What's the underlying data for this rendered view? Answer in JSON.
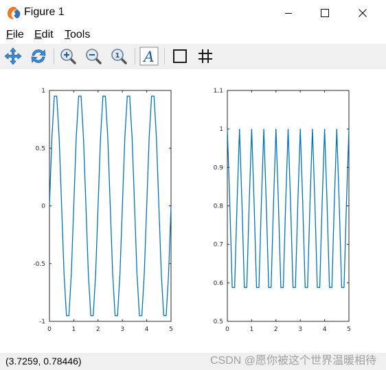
{
  "window": {
    "title": "Figure 1",
    "controls": [
      "minimize",
      "maximize",
      "close"
    ]
  },
  "menu": {
    "items": [
      {
        "label": "File",
        "mnemonic": "F",
        "rest": "ile"
      },
      {
        "label": "Edit",
        "mnemonic": "E",
        "rest": "dit"
      },
      {
        "label": "Tools",
        "mnemonic": "T",
        "rest": "ools"
      }
    ]
  },
  "toolbar": {
    "tools": [
      "pan-icon",
      "rotate-icon",
      "zoom-in-icon",
      "zoom-out-icon",
      "zoom-reset-icon",
      "text-icon",
      "axes-box-icon",
      "grid-icon"
    ],
    "text_tool_glyph": "A"
  },
  "status": {
    "coords": "(3.7259, 0.78446)",
    "watermark": "CSDN @愿你被这个世界温暖相待"
  },
  "colors": {
    "line": "#0072bd",
    "toolbar_bg": "#f0f0f0",
    "figure_bg": "#ffffff"
  },
  "chart_data": [
    {
      "type": "line",
      "title": "",
      "xlabel": "",
      "ylabel": "",
      "xlim": [
        0,
        5
      ],
      "ylim": [
        -1,
        1
      ],
      "xticks": [
        "0",
        "1",
        "2",
        "3",
        "4",
        "5"
      ],
      "yticks": [
        "-1",
        "-0.5",
        "0",
        "0.5",
        "1"
      ],
      "series": [
        {
          "x": [
            0,
            0.1,
            0.2,
            0.3,
            0.4,
            0.5,
            0.6,
            0.7,
            0.8,
            0.9,
            1.0,
            1.1,
            1.2,
            1.3,
            1.4,
            1.5,
            1.6,
            1.7,
            1.8,
            1.9,
            2.0,
            2.1,
            2.2,
            2.3,
            2.4,
            2.5,
            2.6,
            2.7,
            2.8,
            2.9,
            3.0,
            3.1,
            3.2,
            3.3,
            3.4,
            3.5,
            3.6,
            3.7,
            3.8,
            3.9,
            4.0,
            4.1,
            4.2,
            4.3,
            4.4,
            4.5,
            4.6,
            4.7,
            4.8,
            4.9,
            5.0
          ],
          "y": [
            0,
            0.588,
            0.951,
            0.951,
            0.588,
            0,
            -0.588,
            -0.951,
            -0.951,
            -0.588,
            0,
            0.588,
            0.951,
            0.951,
            0.588,
            0,
            -0.588,
            -0.951,
            -0.951,
            -0.588,
            0,
            0.588,
            0.951,
            0.951,
            0.588,
            0,
            -0.588,
            -0.951,
            -0.951,
            -0.588,
            0,
            0.588,
            0.951,
            0.951,
            0.588,
            0,
            -0.588,
            -0.951,
            -0.951,
            -0.588,
            0,
            0.588,
            0.951,
            0.951,
            0.588,
            0,
            -0.588,
            -0.951,
            -0.951,
            -0.588,
            0
          ]
        }
      ]
    },
    {
      "type": "line",
      "title": "",
      "xlabel": "",
      "ylabel": "",
      "xlim": [
        0,
        5
      ],
      "ylim": [
        0.5,
        1.1
      ],
      "xticks": [
        "0",
        "1",
        "2",
        "3",
        "4",
        "5"
      ],
      "yticks": [
        "0.5",
        "0.6",
        "0.7",
        "0.8",
        "0.9",
        "1",
        "1.1"
      ],
      "series": [
        {
          "x": [
            0,
            0.1,
            0.2,
            0.3,
            0.4,
            0.5,
            0.6,
            0.7,
            0.8,
            0.9,
            1.0,
            1.1,
            1.2,
            1.3,
            1.4,
            1.5,
            1.6,
            1.7,
            1.8,
            1.9,
            2.0,
            2.1,
            2.2,
            2.3,
            2.4,
            2.5,
            2.6,
            2.7,
            2.8,
            2.9,
            3.0,
            3.1,
            3.2,
            3.3,
            3.4,
            3.5,
            3.6,
            3.7,
            3.8,
            3.9,
            4.0,
            4.1,
            4.2,
            4.3,
            4.4,
            4.5,
            4.6,
            4.7,
            4.8,
            4.9,
            5.0
          ],
          "y": [
            1.0,
            0.809,
            0.588,
            0.588,
            0.809,
            1.0,
            0.809,
            0.588,
            0.588,
            0.809,
            1.0,
            0.809,
            0.588,
            0.588,
            0.809,
            1.0,
            0.809,
            0.588,
            0.588,
            0.809,
            1.0,
            0.809,
            0.588,
            0.588,
            0.809,
            1.0,
            0.809,
            0.588,
            0.588,
            0.809,
            1.0,
            0.809,
            0.588,
            0.588,
            0.809,
            1.0,
            0.809,
            0.588,
            0.588,
            0.809,
            1.0,
            0.809,
            0.588,
            0.588,
            0.809,
            1.0,
            0.809,
            0.588,
            0.588,
            0.809,
            1.0
          ]
        }
      ]
    }
  ]
}
